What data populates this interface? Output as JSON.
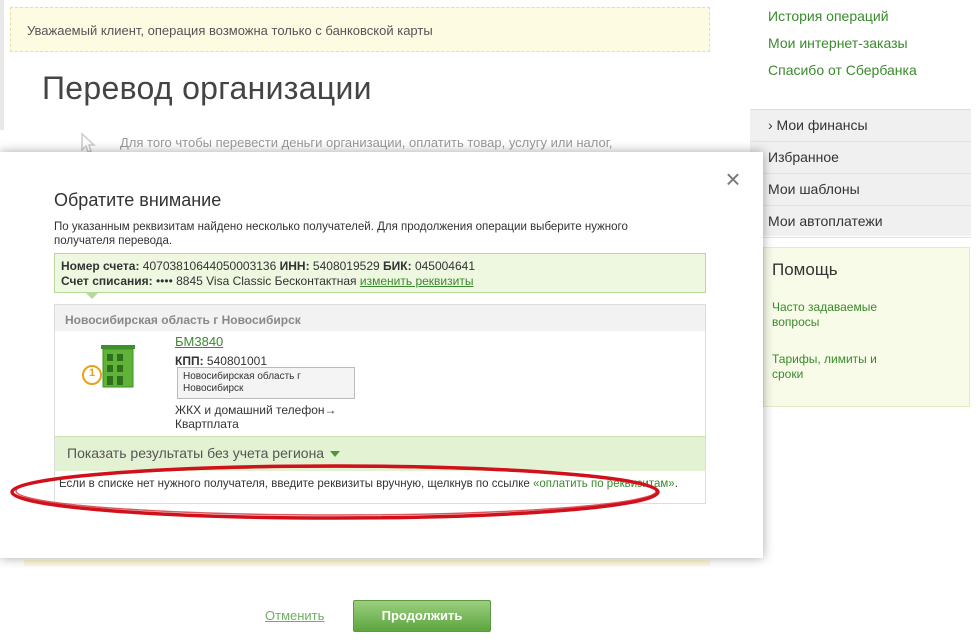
{
  "alert": "Уважаемый клиент, операция возможна только с банковской карты",
  "page_title": "Перевод организации",
  "intro_text": "Для того чтобы перевести деньги организации, оплатить товар, услугу или налог,",
  "sidebar": {
    "links": [
      "История операций",
      "Мои интернет-заказы",
      "Спасибо от Сбербанка"
    ],
    "menu": [
      "› Мои финансы",
      "Избранное",
      "Мои шаблоны",
      "Мои автоплатежи"
    ],
    "help_title": "Помощь",
    "help_links": [
      "Часто задаваемые вопросы",
      "Тарифы, лимиты и сроки"
    ]
  },
  "modal": {
    "title": "Обратите внимание",
    "description": "По указанным реквизитам найдено несколько получателей. Для продолжения операции выберите нужного получателя перевода.",
    "account_label": "Номер счета:",
    "account_value": "40703810644050003136",
    "inn_label": "ИНН:",
    "inn_value": "5408019529",
    "bik_label": "БИК:",
    "bik_value": "045004641",
    "debit_label": "Счет списания:",
    "debit_value": "•••• 8845 Visa Classic Бесконтактная",
    "change_link": "изменить реквизиты",
    "region_header": "Новосибирская область г Новосибирск",
    "org_name": "БМ3840",
    "kpp_label": "КПП:",
    "kpp_value": "540801001",
    "region_tag": "Новосибирская область г Новосибирск",
    "category": "ЖКХ и домашний телефон→ Квартплата",
    "badge_number": "1",
    "show_all": "Показать результаты без учета региона",
    "manual_note": "Если в списке нет нужного получателя, введите реквизиты вручную, щелкнув по ссылке",
    "manual_link": "«оплатить по реквизитам»",
    "manual_end": "."
  },
  "buttons": {
    "cancel": "Отменить",
    "continue": "Продолжить"
  },
  "colors": {
    "accent_green": "#3b8a2e",
    "annotation_red": "#d0111b"
  }
}
